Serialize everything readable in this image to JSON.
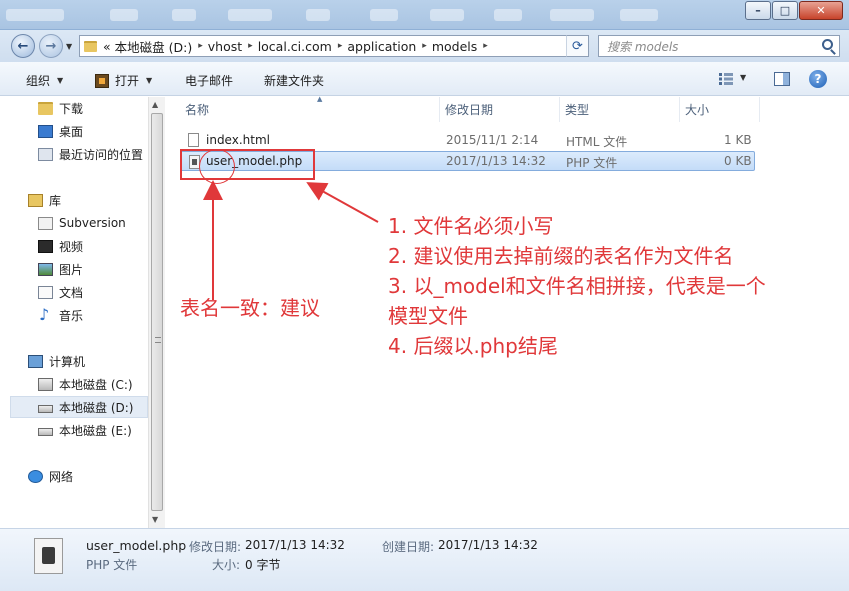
{
  "window": {
    "controls": {
      "minimize": "–",
      "maximize": "□",
      "close": "✕"
    }
  },
  "address": {
    "overflow": "«",
    "crumbs": [
      "本地磁盘 (D:)",
      "vhost",
      "local.ci.com",
      "application",
      "models"
    ],
    "search_placeholder": "搜索 models"
  },
  "toolbar": {
    "organize": "组织",
    "open": "打开",
    "email": "电子邮件",
    "new_folder": "新建文件夹",
    "help": "?"
  },
  "nav": {
    "favorites": [
      {
        "label": "下载",
        "icon": "folder-icon"
      },
      {
        "label": "桌面",
        "icon": "desktop-icon"
      },
      {
        "label": "最近访问的位置",
        "icon": "recent-places-icon"
      }
    ],
    "libraries": {
      "label": "库",
      "icon": "library-icon"
    },
    "library_items": [
      {
        "label": "Subversion",
        "icon": "subversion-icon"
      },
      {
        "label": "视频",
        "icon": "video-icon"
      },
      {
        "label": "图片",
        "icon": "picture-icon"
      },
      {
        "label": "文档",
        "icon": "document-icon"
      },
      {
        "label": "音乐",
        "icon": "music-icon"
      }
    ],
    "computer": {
      "label": "计算机",
      "icon": "computer-icon"
    },
    "drives": [
      {
        "label": "本地磁盘 (C:)",
        "icon": "drive-icon"
      },
      {
        "label": "本地磁盘 (D:)",
        "icon": "drive-icon",
        "selected": true
      },
      {
        "label": "本地磁盘 (E:)",
        "icon": "drive-icon"
      }
    ],
    "network": {
      "label": "网络",
      "icon": "network-icon"
    }
  },
  "columns": {
    "name": "名称",
    "modified": "修改日期",
    "type": "类型",
    "size": "大小"
  },
  "files": [
    {
      "name": "index.html",
      "modified": "2015/11/1 2:14",
      "type": "HTML 文件",
      "size": "1 KB",
      "icon": "html-file-icon"
    },
    {
      "name": "user_model.php",
      "modified": "2017/1/13 14:32",
      "type": "PHP 文件",
      "size": "0 KB",
      "icon": "php-file-icon",
      "selected": true
    }
  ],
  "annotations": {
    "left_note": "表名一致：建议",
    "rules": [
      "1. 文件名必须小写",
      "2. 建议使用去掉前缀的表名作为文件名",
      "3. 以_model和文件名相拼接，代表是一个",
      "模型文件",
      "4. 后缀以.php结尾"
    ],
    "color": "#e0383a"
  },
  "details": {
    "filename": "user_model.php",
    "filetype": "PHP 文件",
    "modified_label": "修改日期:",
    "modified_value": "2017/1/13 14:32",
    "created_label": "创建日期:",
    "created_value": "2017/1/13 14:32",
    "size_label": "大小:",
    "size_value": "0 字节"
  }
}
